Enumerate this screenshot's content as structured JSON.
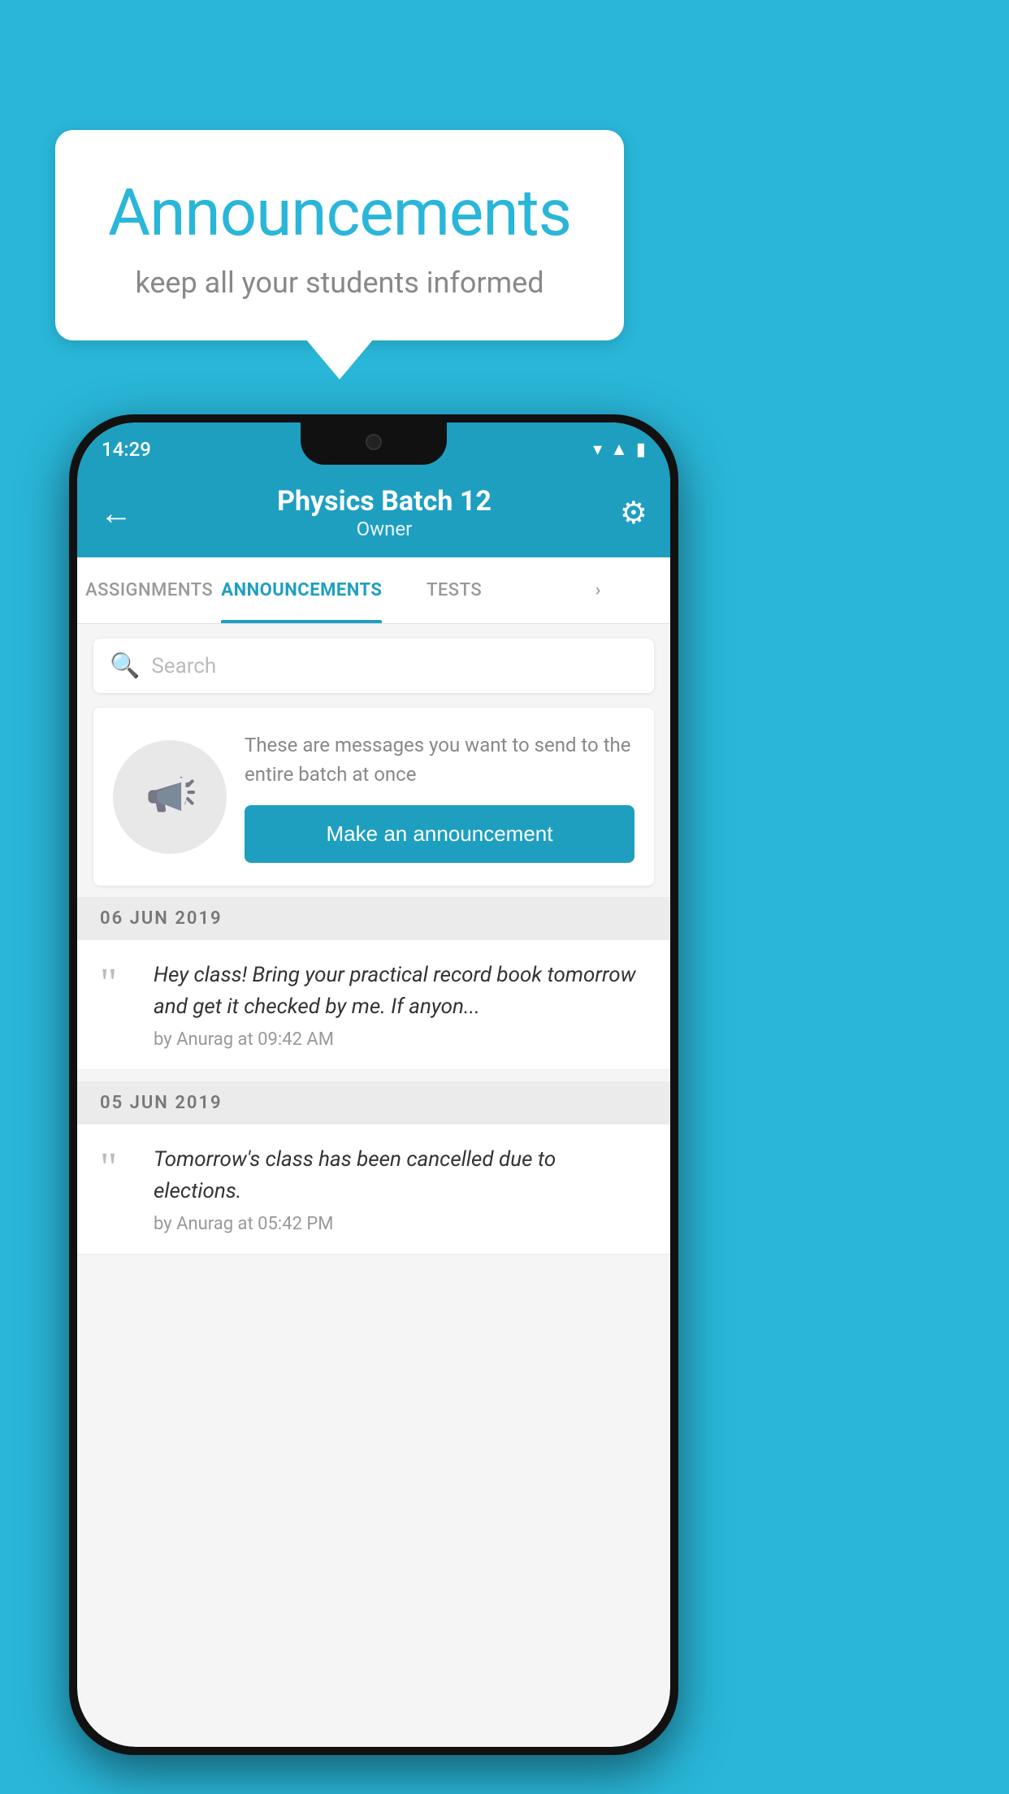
{
  "background": {
    "color": "#29b6d8"
  },
  "speech_bubble": {
    "title": "Announcements",
    "subtitle": "keep all your students informed"
  },
  "phone": {
    "status_bar": {
      "time": "14:29"
    },
    "app_bar": {
      "back_label": "←",
      "title": "Physics Batch 12",
      "subtitle": "Owner",
      "settings_icon": "⚙"
    },
    "tabs": [
      {
        "label": "ASSIGNMENTS",
        "active": false
      },
      {
        "label": "ANNOUNCEMENTS",
        "active": true
      },
      {
        "label": "TESTS",
        "active": false
      },
      {
        "label": "",
        "active": false
      }
    ],
    "search": {
      "placeholder": "Search"
    },
    "announcement_prompt": {
      "description": "These are messages you want to send to the entire batch at once",
      "button_label": "Make an announcement"
    },
    "announcements": [
      {
        "date": "06  JUN  2019",
        "text": "Hey class! Bring your practical record book tomorrow and get it checked by me. If anyon...",
        "meta": "by Anurag at 09:42 AM"
      },
      {
        "date": "05  JUN  2019",
        "text": "Tomorrow's class has been cancelled due to elections.",
        "meta": "by Anurag at 05:42 PM"
      }
    ]
  }
}
